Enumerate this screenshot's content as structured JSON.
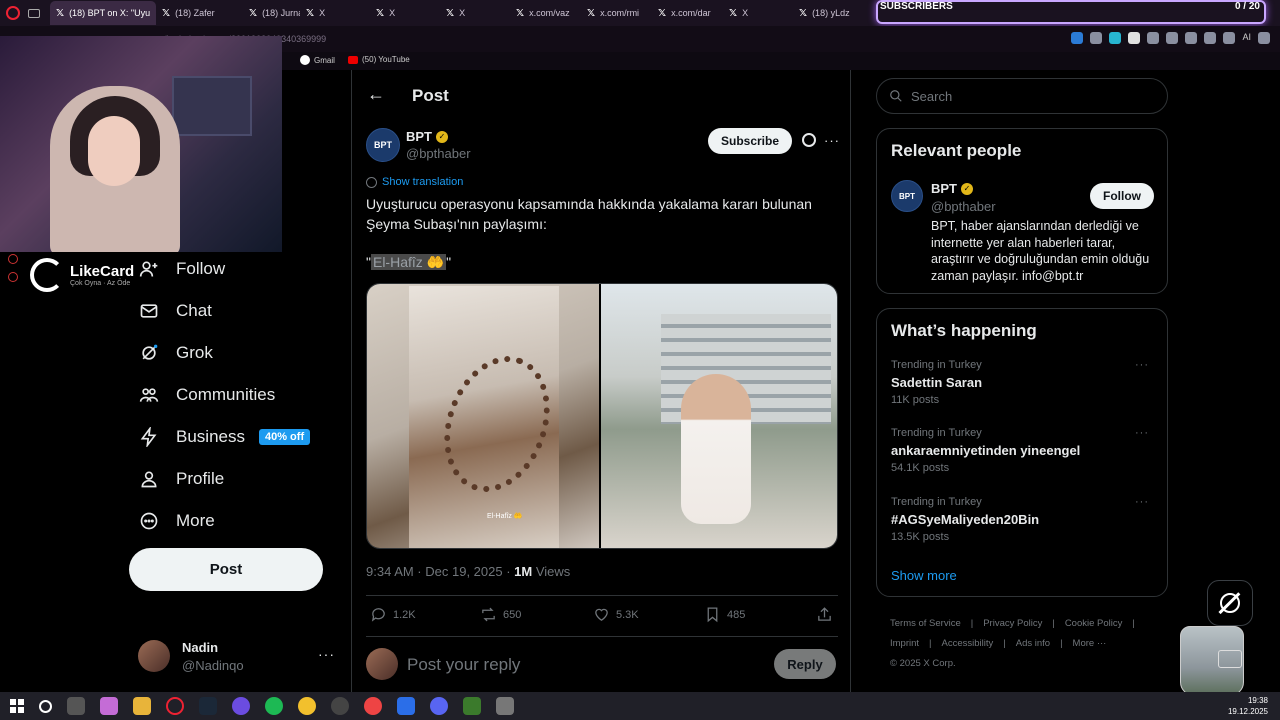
{
  "browser": {
    "tabs": [
      {
        "label": "(18) BPT on X: \"Uyu",
        "active": true
      },
      {
        "label": "(18) Zafer"
      },
      {
        "label": "(18) Jurna"
      },
      {
        "label": "X"
      },
      {
        "label": "X"
      },
      {
        "label": "X"
      },
      {
        "label": "x.com/vaz"
      },
      {
        "label": "x.com/rmi"
      },
      {
        "label": "x.com/dar"
      },
      {
        "label": "X"
      },
      {
        "label": "(18) yLdz"
      }
    ],
    "url": "x.com/bpthaber/status/2001903040340369999",
    "bookmarks": [
      {
        "label": "Gmail",
        "icon": "google-icon"
      },
      {
        "label": "(50) YouTube",
        "icon": "youtube-icon"
      }
    ],
    "ai_label": "AI"
  },
  "overlay": {
    "subscribers_label": "SUBSCRIBERS",
    "subscribers_count": "0 / 20",
    "sponsor_name": "LikeCard",
    "sponsor_tagline": "Çok Oyna · Az Öde"
  },
  "nav": {
    "items": [
      {
        "label": "Follow",
        "icon": "follow-icon"
      },
      {
        "label": "Chat",
        "icon": "mail-icon"
      },
      {
        "label": "Grok",
        "icon": "grok-icon"
      },
      {
        "label": "Communities",
        "icon": "communities-icon"
      },
      {
        "label": "Business",
        "icon": "lightning-icon",
        "badge": "40% off"
      },
      {
        "label": "Profile",
        "icon": "profile-icon"
      },
      {
        "label": "More",
        "icon": "more-circle-icon"
      }
    ],
    "post_label": "Post",
    "account": {
      "name": "Nadin",
      "handle": "@Nadinqo",
      "more": "···"
    }
  },
  "post": {
    "header_title": "Post",
    "author": {
      "name": "BPT",
      "handle": "@bpthaber",
      "avatar_text": "BPT"
    },
    "subscribe_label": "Subscribe",
    "show_translation": "Show translation",
    "text": "Uyuşturucu operasyonu kapsamında hakkında yakalama kararı bulunan Şeyma Subaşı'nın paylaşımı:",
    "quote_open": "\"",
    "quote_highlight": "El-Hafîz 🤲",
    "quote_close": "\"",
    "media_caption": "El-Hafîz 🤲",
    "meta": {
      "time": "9:34 AM · Dec 19, 2025 · ",
      "views_count": "1M",
      "views_label": " Views"
    },
    "stats": {
      "replies": "1.2K",
      "reposts": "650",
      "likes": "5.3K",
      "bookmarks": "485"
    },
    "reply_placeholder": "Post your reply",
    "reply_label": "Reply"
  },
  "sidebar": {
    "search_placeholder": "Search",
    "relevant": {
      "title": "Relevant people",
      "name": "BPT",
      "handle": "@bpthaber",
      "avatar_text": "BPT",
      "follow_label": "Follow",
      "bio": "BPT, haber ajanslarından derlediği ve internette yer alan haberleri tarar, araştırır ve doğruluğundan emin olduğu zaman paylaşır. info@bpt.tr"
    },
    "happening": {
      "title": "What’s happening",
      "trends": [
        {
          "context": "Trending in Turkey",
          "name": "Sadettin Saran",
          "posts": "11K posts"
        },
        {
          "context": "Trending in Turkey",
          "name": "ankaraemniyetinden yineengel",
          "posts": "54.1K posts"
        },
        {
          "context": "Trending in Turkey",
          "name": "#AGSyeMaliyeden20Bin",
          "posts": "13.5K posts"
        }
      ],
      "show_more": "Show more"
    },
    "footer": [
      "Terms of Service",
      "|",
      "Privacy Policy",
      "|",
      "Cookie Policy",
      "|",
      "Imprint",
      "|",
      "Accessibility",
      "|",
      "Ads info",
      "|",
      "More ···",
      "© 2025 X Corp."
    ]
  },
  "taskbar": {
    "time": "19:38",
    "date": "19.12.2025"
  },
  "colors": {
    "accent": "#1d9bf0",
    "background": "#000000",
    "verified_gold": "#e2b719",
    "text_secondary": "#71767b"
  }
}
